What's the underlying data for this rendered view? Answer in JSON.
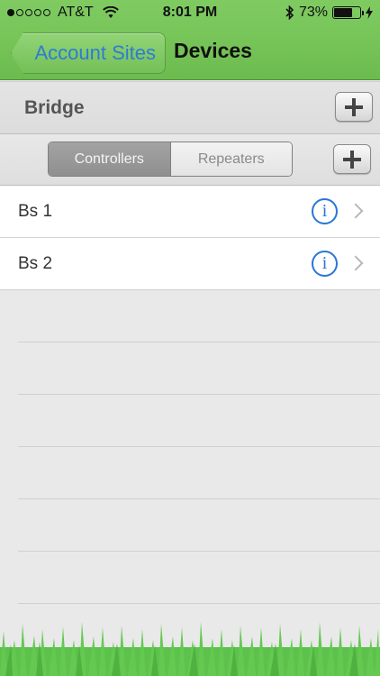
{
  "status_bar": {
    "carrier": "AT&T",
    "time": "8:01 PM",
    "battery": "73%",
    "battery_level": 0.73,
    "signal_bars_filled": 1,
    "signal_bars_total": 5
  },
  "nav": {
    "back_label": "Account Sites",
    "title": "Devices"
  },
  "bridge": {
    "label": "Bridge"
  },
  "segments": {
    "items": [
      "Controllers",
      "Repeaters"
    ],
    "selected": "Controllers"
  },
  "devices": [
    {
      "label": "Bs 1"
    },
    {
      "label": "Bs 2"
    }
  ],
  "colors": {
    "nav_green": "#75c357",
    "link_blue": "#2e7bd6",
    "info_blue": "#2a76d6",
    "grass_green": "#5cc24c"
  },
  "icons": [
    "wifi-icon",
    "bluetooth-icon",
    "battery-icon",
    "charging-icon",
    "plus-icon",
    "info-icon",
    "chevron-right-icon"
  ]
}
